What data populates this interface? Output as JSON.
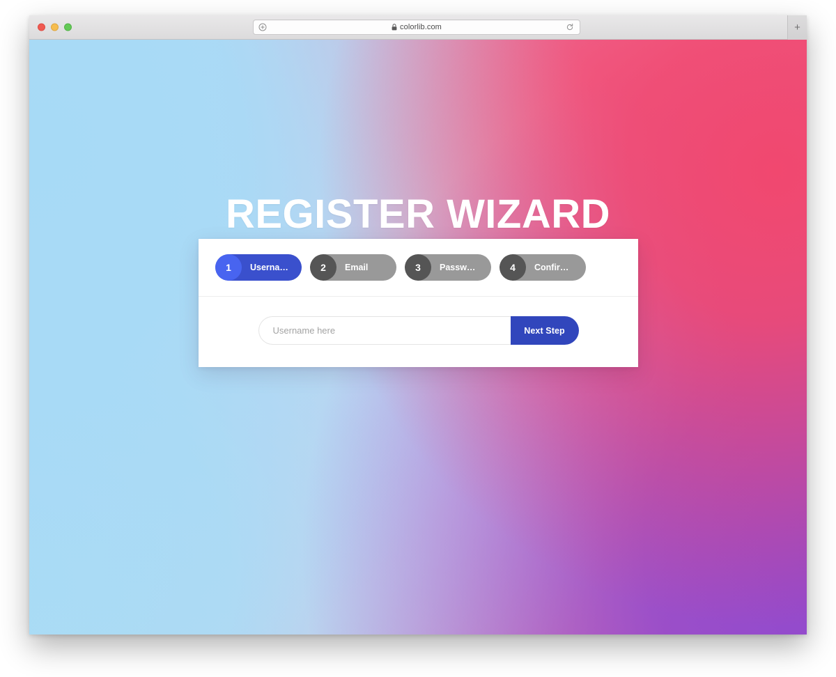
{
  "browser": {
    "traffic_lights": [
      "close",
      "minimize",
      "zoom"
    ],
    "address": {
      "left_icon": "info-circle-icon",
      "lock_icon": "lock-icon",
      "url": "colorlib.com",
      "reload_icon": "reload-icon"
    },
    "new_tab_label": "+"
  },
  "page": {
    "title": "REGISTER WIZARD",
    "background_colors": {
      "blue": "#a7daf6",
      "lavender": "#d3cdee",
      "pink": "#f1486f",
      "purple": "#9049cd"
    }
  },
  "wizard": {
    "steps": [
      {
        "number": "1",
        "label": "Username",
        "state": "active"
      },
      {
        "number": "2",
        "label": "Email",
        "state": "idle"
      },
      {
        "number": "3",
        "label": "Password",
        "state": "idle"
      },
      {
        "number": "4",
        "label": "Confirm Pas...",
        "state": "idle"
      }
    ],
    "form": {
      "input_value": "",
      "input_placeholder": "Username here",
      "submit_label": "Next Step"
    },
    "colors": {
      "active_pill": "#3a50cd",
      "active_badge": "#4864f0",
      "idle_pill": "#999999",
      "idle_badge": "#555555",
      "button": "#3146bc"
    }
  }
}
